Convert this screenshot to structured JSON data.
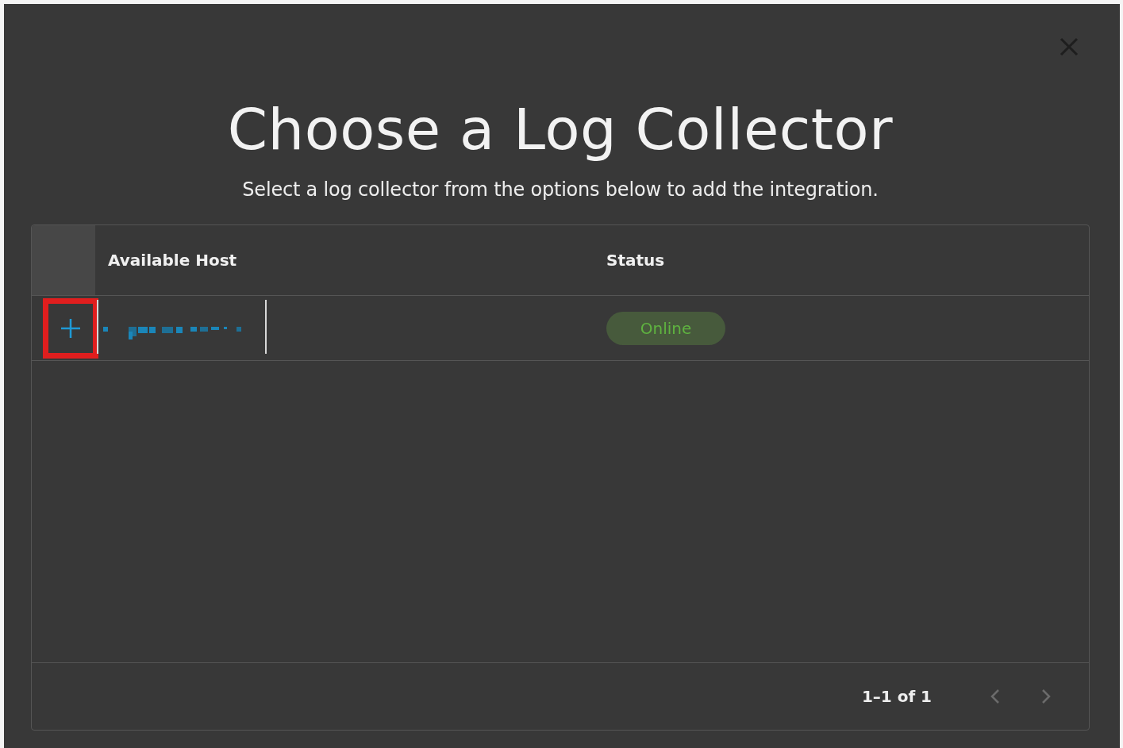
{
  "dialog": {
    "title": "Choose a Log Collector",
    "subtitle": "Select a log collector from the options below to add the integration."
  },
  "table": {
    "columns": [
      "Available Host",
      "Status"
    ],
    "rows": [
      {
        "highlighted": true,
        "status": {
          "label": "Online",
          "kind": "online"
        }
      }
    ]
  },
  "pagination": {
    "range": "1–1 of 1",
    "prev_disabled": true,
    "next_disabled": true
  }
}
